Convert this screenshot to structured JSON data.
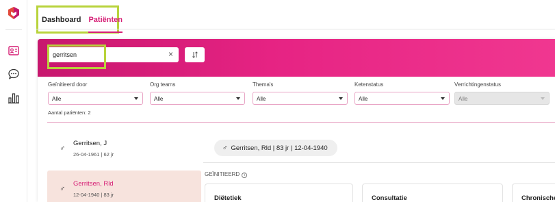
{
  "nav": {
    "tabs": [
      {
        "label": "Dashboard"
      },
      {
        "label": "Patiënten"
      }
    ]
  },
  "search": {
    "value": "gerritsen",
    "clear_label": "×",
    "sort_label": "↓↑"
  },
  "filters": [
    {
      "label": "Geïnitieerd door",
      "value": "Alle"
    },
    {
      "label": "Org teams",
      "value": "Alle"
    },
    {
      "label": "Thema's",
      "value": "Alle"
    },
    {
      "label": "Ketenstatus",
      "value": "Alle"
    },
    {
      "label": "Verrichtingenstatus",
      "value": "Alle"
    }
  ],
  "patient_count": "Aantal patiënten: 2",
  "patients": [
    {
      "gender": "♂",
      "name": "Gerritsen, J",
      "meta": "26-04-1961 | 62 jr"
    },
    {
      "gender": "♂",
      "name": "Gerritsen, Rld",
      "meta": "12-04-1940 | 83 jr"
    }
  ],
  "selected": {
    "gender": "♂",
    "summary": "Gerritsen, Rld | 83 jr | 12-04-1940"
  },
  "section": {
    "label": "GEÏNITIEERD",
    "info": "i"
  },
  "tiles": [
    {
      "label": "Diëtetiek"
    },
    {
      "label": "Consultatie"
    },
    {
      "label": "Chronische z"
    }
  ],
  "colors": {
    "accent": "#d61f75",
    "highlight": "#b8d33b",
    "banner": "#e62383",
    "selected_row": "#f7e3dd"
  }
}
